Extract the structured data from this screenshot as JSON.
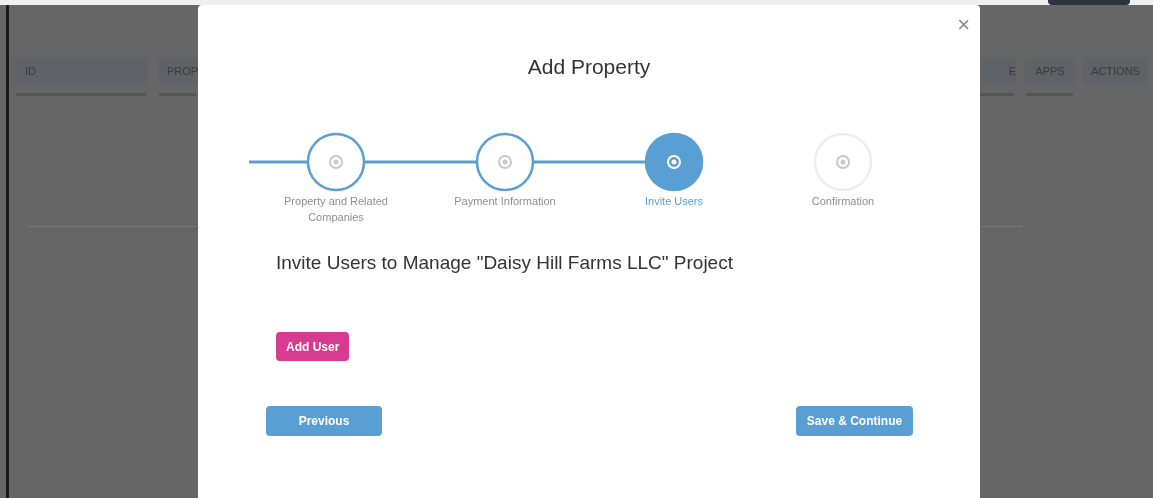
{
  "background_table": {
    "columns": [
      {
        "label": "ID"
      },
      {
        "label": "PROP"
      },
      {
        "label": "E"
      },
      {
        "label": "APPS"
      },
      {
        "label": "ACTIONS"
      }
    ]
  },
  "modal": {
    "title": "Add Property",
    "close": "×",
    "steps": [
      {
        "label": "Property and Related Companies",
        "completed": true,
        "selected": false
      },
      {
        "label": "Payment Information",
        "completed": true,
        "selected": false
      },
      {
        "label": "Invite Users",
        "completed": false,
        "selected": true
      },
      {
        "label": "Confirmation",
        "completed": false,
        "selected": false
      }
    ],
    "heading": "Invite Users to Manage \"Daisy Hill Farms LLC\" Project",
    "add_user_button": "Add User",
    "buttons": [
      {
        "label": "Previous"
      },
      {
        "label": "Save & Continue"
      }
    ]
  }
}
